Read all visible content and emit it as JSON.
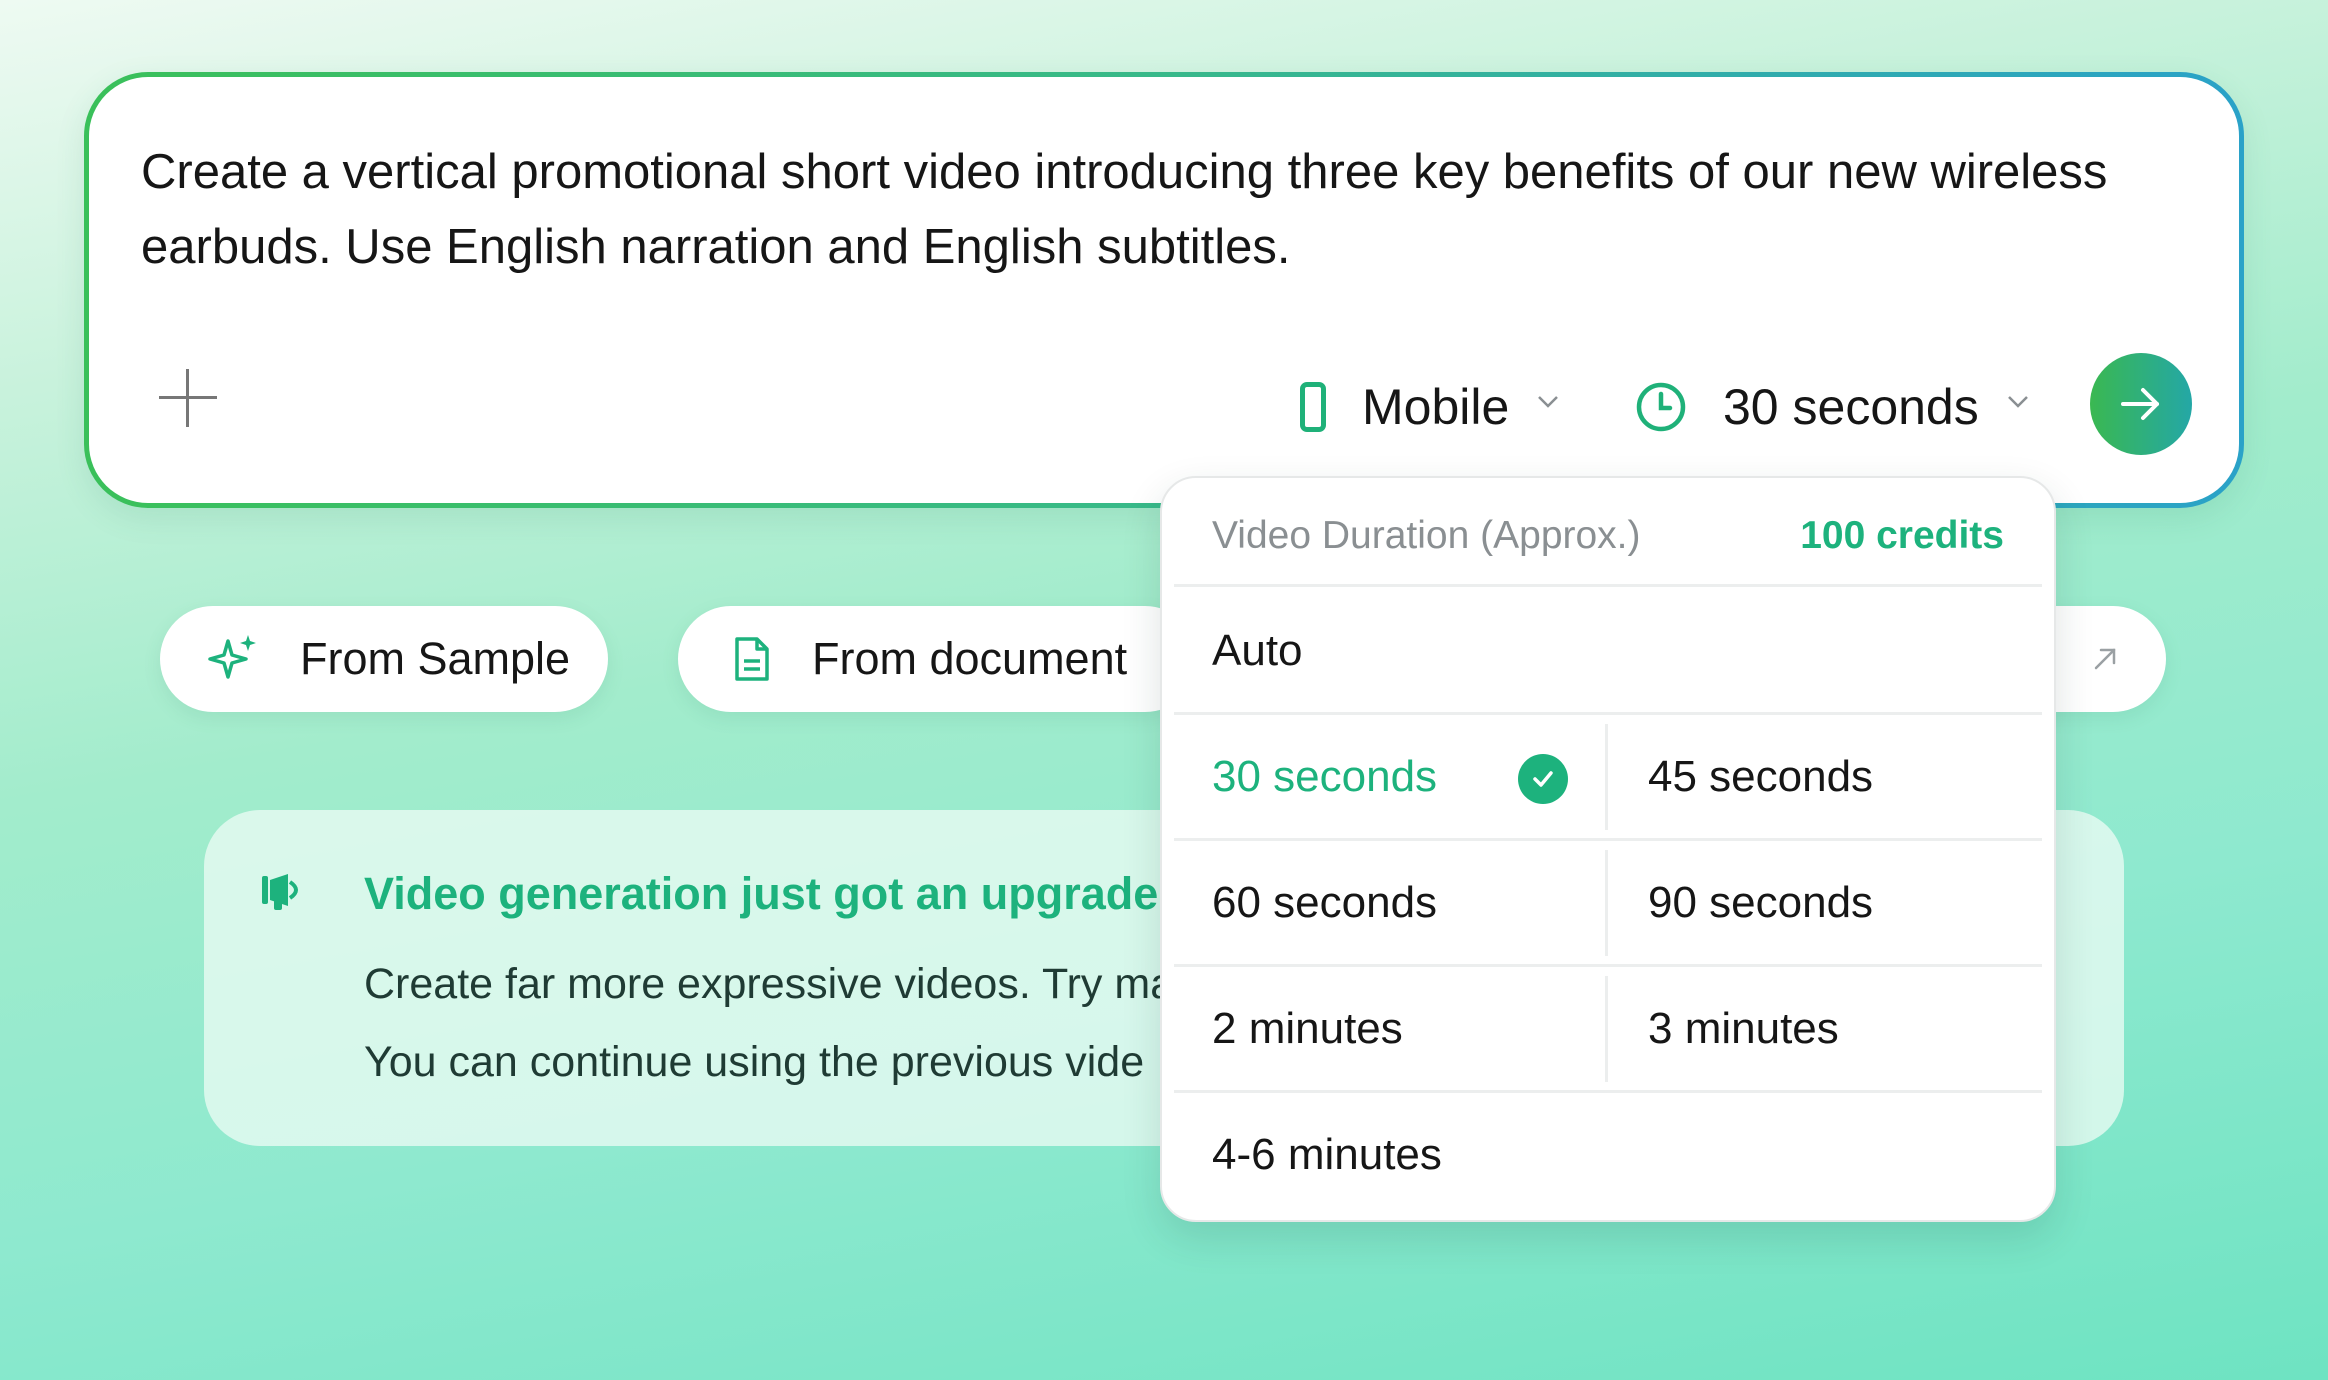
{
  "prompt": {
    "text": "Create a vertical promotional short video introducing three key benefits of our new wireless earbuds. Use English narration and English subtitles."
  },
  "toolbar": {
    "format_label": "Mobile",
    "duration_label": "30 seconds"
  },
  "pills": {
    "sample_label": "From Sample",
    "document_label": "From document"
  },
  "notice": {
    "title": "Video generation just got an upgrade!",
    "line1": "Create far more expressive videos. Try ma",
    "line2": "You can continue using the previous vide"
  },
  "duration_menu": {
    "header": "Video Duration (Approx.)",
    "credits": "100 credits",
    "options": {
      "auto": "Auto",
      "s30": "30 seconds",
      "s45": "45 seconds",
      "s60": "60 seconds",
      "s90": "90 seconds",
      "m2": "2 minutes",
      "m3": "3 minutes",
      "m4_6": "4-6 minutes"
    },
    "selected": "30 seconds"
  },
  "colors": {
    "accent": "#1db27d",
    "border_start": "#3ac05a",
    "border_end": "#2aa2c8"
  }
}
